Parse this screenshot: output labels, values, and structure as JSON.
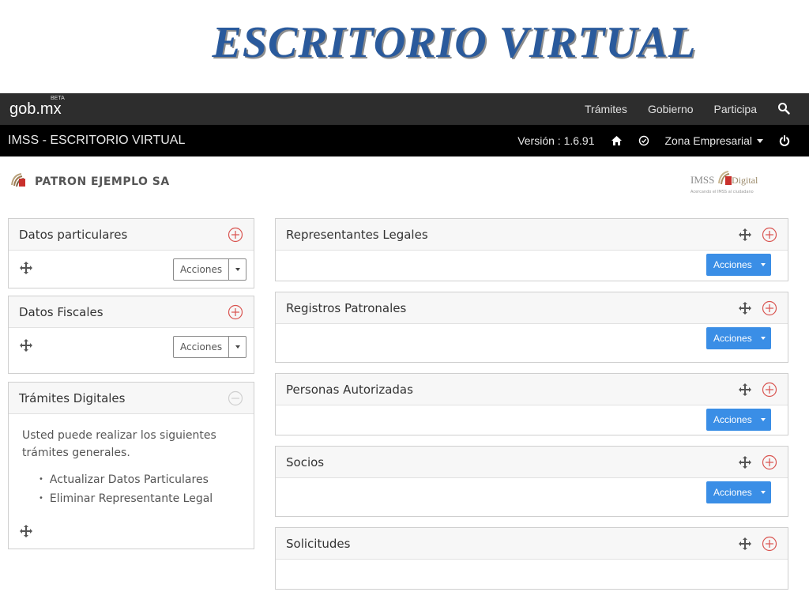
{
  "slide": {
    "title": "ESCRITORIO VIRTUAL"
  },
  "gob": {
    "logo": "gob.mx",
    "beta": "BETA",
    "nav": [
      "Trámites",
      "Gobierno",
      "Participa"
    ],
    "search_icon": "search-icon"
  },
  "imss": {
    "title": "IMSS - ESCRITORIO VIRTUAL",
    "version": "Versión : 1.6.91",
    "home_icon": "home-icon",
    "clock_icon": "clock-icon",
    "zona": "Zona Empresarial",
    "power_icon": "power-icon"
  },
  "patron": {
    "name": "PATRON EJEMPLO SA",
    "brand": "IMSS",
    "brand_digital": "Digital",
    "brand_tagline": "Acercando el IMSS al ciudadano"
  },
  "left_panels": [
    {
      "title": "Datos particulares",
      "button": "Acciones"
    },
    {
      "title": "Datos Fiscales",
      "button": "Acciones"
    },
    {
      "title": "Trámites Digitales",
      "text": "Usted puede realizar los siguientes trámites generales.",
      "items": [
        "Actualizar Datos Particulares",
        "Eliminar Representante Legal"
      ]
    }
  ],
  "right_panels": [
    {
      "title": "Representantes Legales",
      "button": "Acciones"
    },
    {
      "title": "Registros Patronales",
      "button": "Acciones"
    },
    {
      "title": "Personas Autorizadas",
      "button": "Acciones"
    },
    {
      "title": "Socios",
      "button": "Acciones"
    },
    {
      "title": "Solicitudes"
    }
  ],
  "colors": {
    "accent_blue": "#3a8ee6",
    "plus_red": "#d9534f",
    "title_blue": "#2a5a9c",
    "gob_bar": "#2d2d2d",
    "imss_bar": "#000000"
  }
}
